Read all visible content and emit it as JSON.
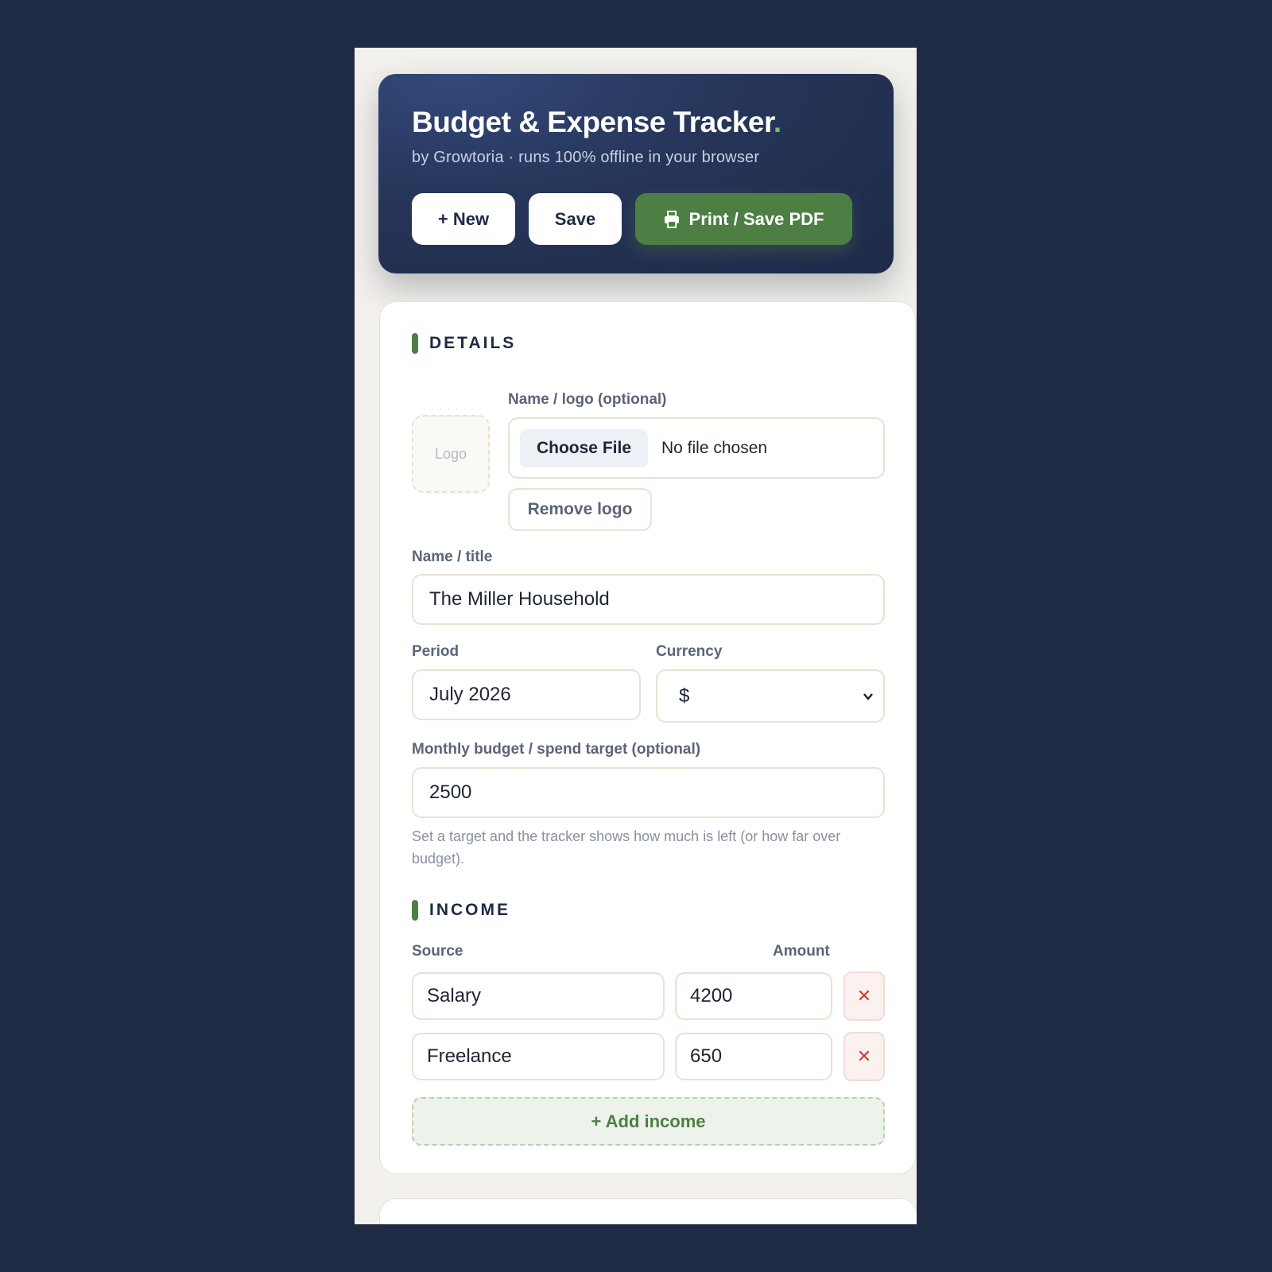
{
  "header": {
    "title": "Budget & Expense Tracker",
    "title_dot": ".",
    "subtitle": "by Growtoria · runs 100% offline in your browser",
    "new_label": "+ New",
    "save_label": "Save",
    "print_label": "Print / Save PDF"
  },
  "details": {
    "section_title": "DETAILS",
    "logo_placeholder": "Logo",
    "logo_label": "Name / logo (optional)",
    "choose_file_label": "Choose File",
    "no_file_text": "No file chosen",
    "remove_logo_label": "Remove logo",
    "name_label": "Name / title",
    "name_value": "The Miller Household",
    "period_label": "Period",
    "period_value": "July 2026",
    "currency_label": "Currency",
    "currency_value": "$",
    "budget_label": "Monthly budget / spend target (optional)",
    "budget_value": "2500",
    "budget_hint": "Set a target and the tracker shows how much is left (or how far over budget)."
  },
  "income": {
    "section_title": "INCOME",
    "source_header": "Source",
    "amount_header": "Amount",
    "rows": [
      {
        "source": "Salary",
        "amount": "4200",
        "remove": "✕"
      },
      {
        "source": "Freelance",
        "amount": "650",
        "remove": "✕"
      }
    ],
    "add_label": "+ Add income"
  },
  "colors": {
    "page_bg": "#1f2a44",
    "accent_green": "#4d7f45",
    "danger": "#c8433a"
  }
}
